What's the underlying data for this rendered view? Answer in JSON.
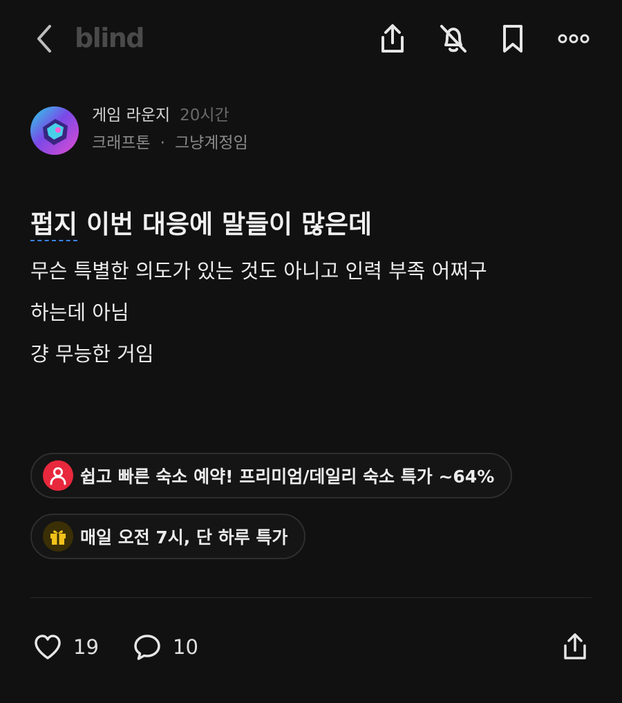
{
  "header": {
    "logo_text": "blind",
    "icons": [
      "back-chevron-icon",
      "share-icon",
      "bell-off-icon",
      "bookmark-icon",
      "more-icon"
    ]
  },
  "post": {
    "channel": "게임 라운지",
    "time": "20시간",
    "company": "크래프톤",
    "separator": "·",
    "nickname": "그냥계정임",
    "title_underlined": "펍지",
    "title_rest": " 이번 대응에 말들이 많은데",
    "body_lines": [
      "무슨 특별한 의도가 있는 것도 아니고 인력 부족 어쩌구",
      "하는데 아님",
      "걍 무능한 거임"
    ]
  },
  "ads": [
    {
      "label": "쉽고 빠른 숙소 예약! 프리미엄/데일리 숙소 특가 ~64%",
      "icon": "person-icon",
      "icon_bg": "#e8283c"
    },
    {
      "label": "매일 오전 7시, 단 하루 특가",
      "icon": "gift-icon",
      "icon_bg": "#3a2f05"
    }
  ],
  "actions": {
    "likes": "19",
    "comments": "10"
  },
  "colors": {
    "background": "#111111",
    "accent_underline": "#3b82f6"
  }
}
